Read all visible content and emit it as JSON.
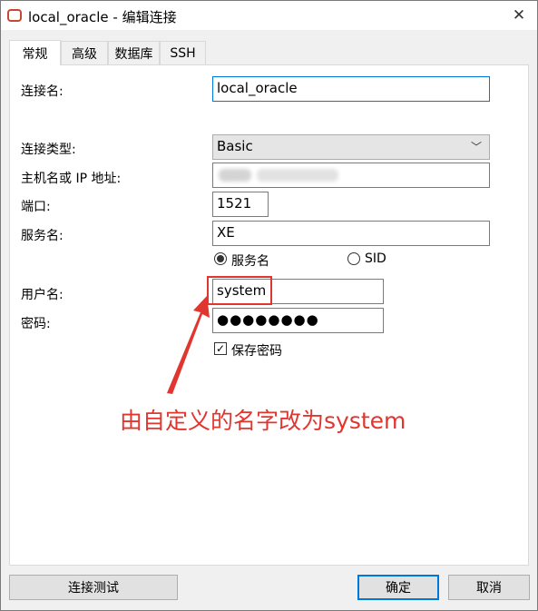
{
  "window": {
    "title": "local_oracle - 编辑连接",
    "app_icon": "oracle-logo-icon",
    "close_glyph": "✕"
  },
  "tabs": [
    {
      "label": "常规",
      "active": true
    },
    {
      "label": "高级",
      "active": false
    },
    {
      "label": "数据库",
      "active": false
    },
    {
      "label": "SSH",
      "active": false
    }
  ],
  "form": {
    "connection_name_label": "连接名:",
    "connection_name_value": "local_oracle",
    "connection_type_label": "连接类型:",
    "connection_type_value": "Basic",
    "host_label": "主机名或 IP 地址:",
    "port_label": "端口:",
    "port_value": "1521",
    "service_name_label": "服务名:",
    "service_name_value": "XE",
    "radio_service_name": "服务名",
    "radio_sid": "SID",
    "username_label": "用户名:",
    "username_value": "system",
    "password_label": "密码:",
    "password_value": "●●●●●●●●",
    "save_password_label": "保存密码",
    "save_password_checked": true
  },
  "annotation": {
    "text": "由自定义的名字改为system",
    "color": "#e0362f"
  },
  "buttons": {
    "test_connection": "连接测试",
    "ok": "确定",
    "cancel": "取消"
  },
  "colors": {
    "accent": "#0078d7",
    "annotation_red": "#e0362f",
    "oracle_red": "#c74634"
  }
}
